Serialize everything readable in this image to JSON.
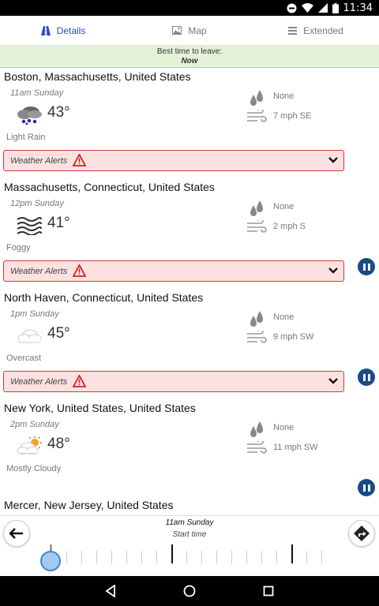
{
  "status_bar": {
    "time": "11:34"
  },
  "tabs": [
    {
      "label": "Details",
      "icon": "road-icon",
      "active": true
    },
    {
      "label": "Map",
      "icon": "image-icon",
      "active": false
    },
    {
      "label": "Extended",
      "icon": "list-icon",
      "active": false
    }
  ],
  "best_time": {
    "label": "Best time to leave:",
    "value": "Now"
  },
  "locations": [
    {
      "name": "Boston, Massachusetts, United States",
      "time": "11am Sunday",
      "icon": "light-rain-icon",
      "temp": "43°",
      "condition": "Light Rain",
      "precip": "None",
      "wind": "7 mph SE",
      "alert": "Weather Alerts"
    },
    {
      "name": "Massachusetts, Connecticut, United States",
      "time": "12pm Sunday",
      "icon": "fog-icon",
      "temp": "41°",
      "condition": "Foggy",
      "precip": "None",
      "wind": "2 mph S",
      "alert": "Weather Alerts"
    },
    {
      "name": "North Haven, Connecticut, United States",
      "time": "1pm Sunday",
      "icon": "overcast-icon",
      "temp": "45°",
      "condition": "Overcast",
      "precip": "None",
      "wind": "9 mph SW",
      "alert": "Weather Alerts"
    },
    {
      "name": "New York, United States, United States",
      "time": "2pm Sunday",
      "icon": "mostly-cloudy-icon",
      "temp": "48°",
      "condition": "Mostly Cloudy",
      "precip": "None",
      "wind": "11 mph SW"
    },
    {
      "name": "Mercer, New Jersey, United States"
    }
  ],
  "timeline": {
    "time": "11am Sunday",
    "label": "Start time"
  },
  "colors": {
    "accent": "#2b45c7",
    "alert_bg": "#fde1e1",
    "alert_border": "#cc3b3b",
    "banner_bg": "#e3f1d6",
    "pause": "#1a4a86"
  }
}
